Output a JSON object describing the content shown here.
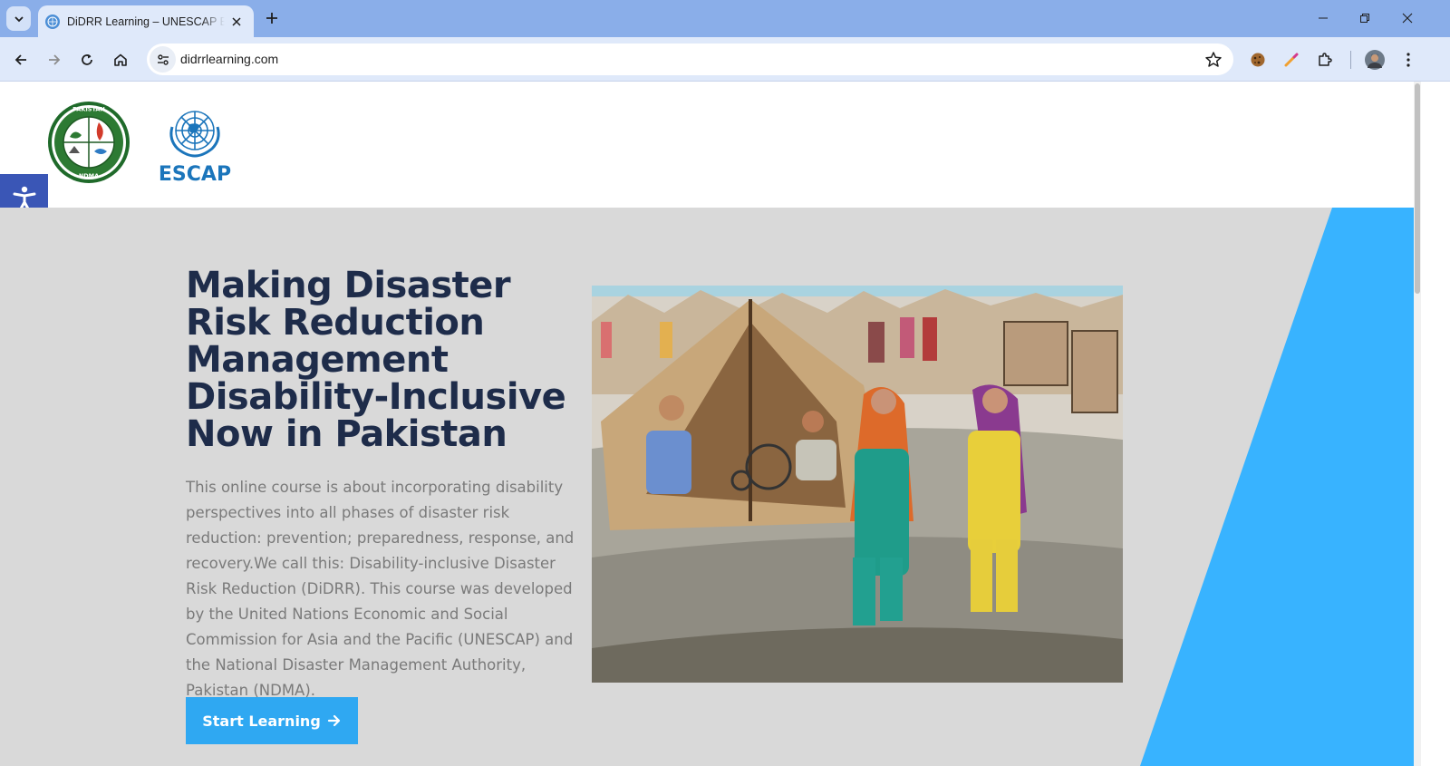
{
  "browser": {
    "tab": {
      "title": "DiDRR Learning – UNESCAP E-L",
      "favicon": "un-globe-icon"
    },
    "address": {
      "url": "didrrlearning.com"
    },
    "colors": {
      "frame": "#8aaee9",
      "toolbar": "#dfe9fa"
    }
  },
  "site": {
    "logos": {
      "ndma_text_top": "PAKISTAN",
      "ndma_text_bottom": "NDMA",
      "escap_text": "ESCAP"
    },
    "hero": {
      "title": "Making Disaster Risk Reduction Management Disability-Inclusive Now in Pakistan",
      "description": "This online course is about incorporating disability perspectives into all phases of disaster risk reduction: prevention; preparedness, response, and recovery.We call this: Disability-inclusive Disaster Risk Reduction (DiDRR). This course was developed by the United Nations Economic and Social Commission for Asia and the Pacific (UNESCAP) and the National Disaster Management Authority, Pakistan (NDMA).",
      "cta_label": "Start Learning",
      "cta_icon": "arrow-right-icon"
    },
    "colors": {
      "title": "#1e2c4a",
      "accent": "#2fa8f2",
      "hero_bg": "#d9d9d9",
      "slant": "#38b3ff",
      "accessibility": "#3a56b6"
    }
  }
}
